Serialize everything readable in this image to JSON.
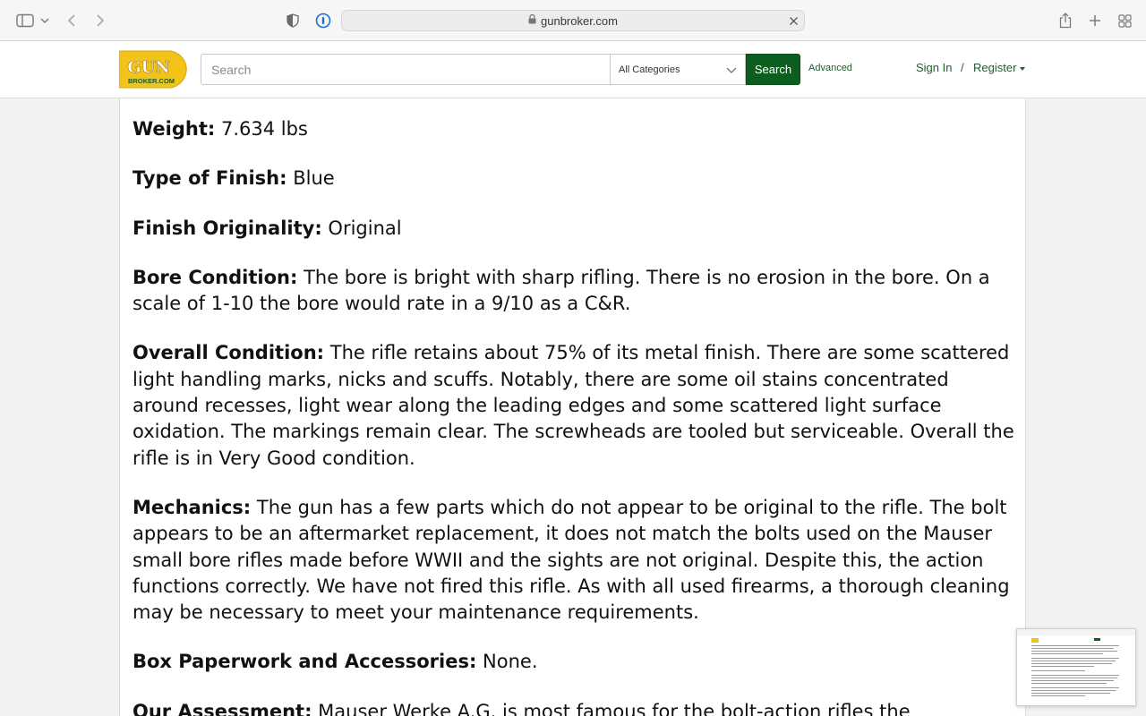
{
  "browser": {
    "url": "gunbroker.com"
  },
  "header": {
    "logo_top": "GUN",
    "logo_bottom": "BROKER.COM",
    "search_placeholder": "Search",
    "category_selected": "All Categories",
    "search_label": "Search",
    "advanced_label": "Advanced",
    "signin_label": "Sign In",
    "separator": "/",
    "register_label": "Register"
  },
  "description": [
    {
      "label": "Weight:",
      "text": " 7.634 lbs"
    },
    {
      "label": "Type of Finish:",
      "text": " Blue"
    },
    {
      "label": "Finish Originality:",
      "text": " Original"
    },
    {
      "label": "Bore Condition:",
      "text": " The bore is bright with sharp rifling. There is no erosion in the bore. On a scale of 1-10 the bore would rate in a 9/10 as a C&R."
    },
    {
      "label": "Overall Condition:",
      "text": " The rifle retains about 75% of its metal finish. There are some scattered light handling marks, nicks and scuffs. Notably, there are some oil stains concentrated around recesses, light wear along the leading edges and some scattered light surface oxidation. The markings remain clear. The screwheads are tooled but serviceable. Overall the rifle is in Very Good condition."
    },
    {
      "label": "Mechanics:",
      "text": " The gun has a few parts which do not appear to be original to the rifle. The bolt appears to be an aftermarket replacement, it does not match the bolts used on the Mauser small bore rifles made before WWII and the sights are not original. Despite this, the action functions correctly. We have not fired this rifle. As with all used firearms, a thorough cleaning may be necessary to meet your maintenance requirements."
    },
    {
      "label": "Box Paperwork and Accessories:",
      "text": " None."
    },
    {
      "label": "Our Assessment:",
      "text": " Mauser Werke A.G. is most famous for the bolt-action rifles the"
    }
  ]
}
